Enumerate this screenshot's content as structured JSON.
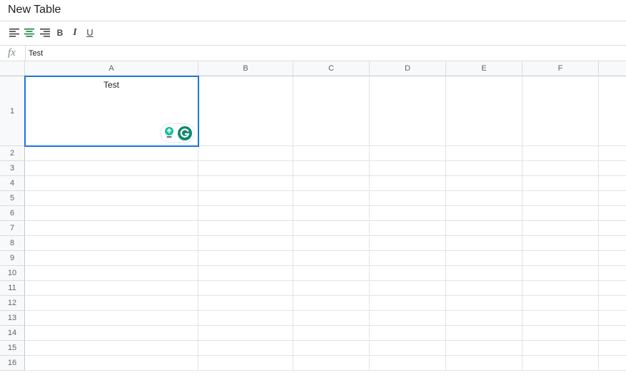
{
  "app": {
    "title": "New Table"
  },
  "toolbar": {
    "bold_label": "B",
    "italic_label": "I",
    "underline_label": "U",
    "active_align": "center",
    "accent_color": "#188038"
  },
  "formula_bar": {
    "fx_label": "fx",
    "value": "Test"
  },
  "columns": [
    {
      "label": "A"
    },
    {
      "label": "B"
    },
    {
      "label": "C"
    },
    {
      "label": "D"
    },
    {
      "label": "E"
    },
    {
      "label": "F"
    },
    {
      "label": ""
    }
  ],
  "rows": [
    {
      "label": "1",
      "cells": [
        "Test",
        "",
        "",
        "",
        "",
        "",
        ""
      ]
    },
    {
      "label": "2",
      "cells": [
        "",
        "",
        "",
        "",
        "",
        "",
        ""
      ]
    },
    {
      "label": "3",
      "cells": [
        "",
        "",
        "",
        "",
        "",
        "",
        ""
      ]
    },
    {
      "label": "4",
      "cells": [
        "",
        "",
        "",
        "",
        "",
        "",
        ""
      ]
    },
    {
      "label": "5",
      "cells": [
        "",
        "",
        "",
        "",
        "",
        "",
        ""
      ]
    },
    {
      "label": "6",
      "cells": [
        "",
        "",
        "",
        "",
        "",
        "",
        ""
      ]
    },
    {
      "label": "7",
      "cells": [
        "",
        "",
        "",
        "",
        "",
        "",
        ""
      ]
    },
    {
      "label": "8",
      "cells": [
        "",
        "",
        "",
        "",
        "",
        "",
        ""
      ]
    },
    {
      "label": "9",
      "cells": [
        "",
        "",
        "",
        "",
        "",
        "",
        ""
      ]
    },
    {
      "label": "10",
      "cells": [
        "",
        "",
        "",
        "",
        "",
        "",
        ""
      ]
    },
    {
      "label": "11",
      "cells": [
        "",
        "",
        "",
        "",
        "",
        "",
        ""
      ]
    },
    {
      "label": "12",
      "cells": [
        "",
        "",
        "",
        "",
        "",
        "",
        ""
      ]
    },
    {
      "label": "13",
      "cells": [
        "",
        "",
        "",
        "",
        "",
        "",
        ""
      ]
    },
    {
      "label": "14",
      "cells": [
        "",
        "",
        "",
        "",
        "",
        "",
        ""
      ]
    },
    {
      "label": "15",
      "cells": [
        "",
        "",
        "",
        "",
        "",
        "",
        ""
      ]
    },
    {
      "label": "16",
      "cells": [
        "",
        "",
        "",
        "",
        "",
        "",
        ""
      ]
    }
  ],
  "selection": {
    "cell": "A1"
  },
  "grammarly_widget": {
    "icons": [
      "grammarly-suggestion-icon",
      "grammarly-logo-icon"
    ],
    "color": "#15c39a"
  }
}
